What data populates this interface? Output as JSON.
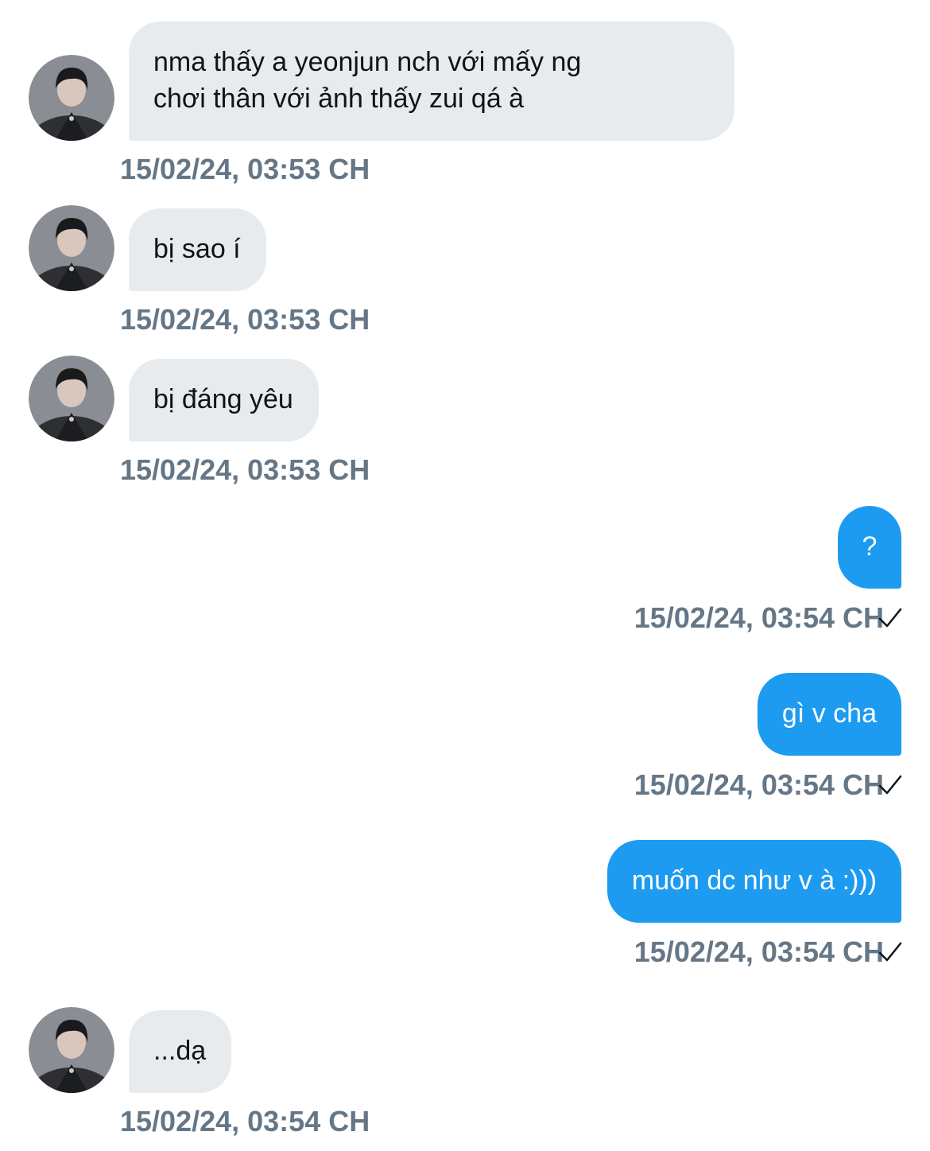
{
  "messages": [
    {
      "side": "in",
      "text": "nma thấy a yeonjun nch với mấy ng\nchơi thân với ảnh thấy zui qá à",
      "time": "15/02/24, 03:53 CH"
    },
    {
      "side": "in",
      "text": "bị sao í",
      "time": "15/02/24, 03:53 CH"
    },
    {
      "side": "in",
      "text": "bị đáng yêu",
      "time": "15/02/24, 03:53 CH"
    },
    {
      "side": "out",
      "text": "?",
      "time": "15/02/24, 03:54 CH",
      "status_icon": "check-icon"
    },
    {
      "side": "out",
      "text": "gì v cha",
      "time": "15/02/24, 03:54 CH",
      "status_icon": "check-icon"
    },
    {
      "side": "out",
      "text": "muốn dc như v à :)))",
      "time": "15/02/24, 03:54 CH",
      "status_icon": "check-icon"
    },
    {
      "side": "in",
      "text": "...dạ",
      "time": "15/02/24, 03:54 CH"
    }
  ],
  "colors": {
    "incoming_bubble": "#e7ebee",
    "outgoing_bubble": "#1d9bf0",
    "timestamp": "#657786",
    "text_dark": "#0f1419"
  },
  "icons": {
    "avatar": "avatar-photo",
    "read_status": "check-icon"
  }
}
